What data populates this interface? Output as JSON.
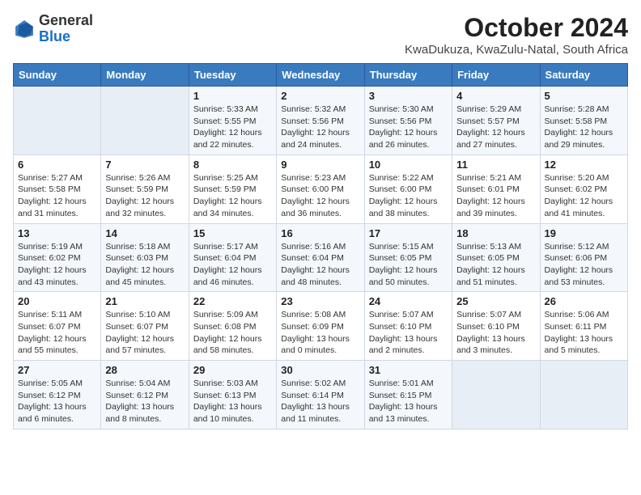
{
  "logo": {
    "text_general": "General",
    "text_blue": "Blue"
  },
  "header": {
    "month": "October 2024",
    "location": "KwaDukuza, KwaZulu-Natal, South Africa"
  },
  "weekdays": [
    "Sunday",
    "Monday",
    "Tuesday",
    "Wednesday",
    "Thursday",
    "Friday",
    "Saturday"
  ],
  "weeks": [
    [
      {
        "day": "",
        "info": ""
      },
      {
        "day": "",
        "info": ""
      },
      {
        "day": "1",
        "info": "Sunrise: 5:33 AM\nSunset: 5:55 PM\nDaylight: 12 hours\nand 22 minutes."
      },
      {
        "day": "2",
        "info": "Sunrise: 5:32 AM\nSunset: 5:56 PM\nDaylight: 12 hours\nand 24 minutes."
      },
      {
        "day": "3",
        "info": "Sunrise: 5:30 AM\nSunset: 5:56 PM\nDaylight: 12 hours\nand 26 minutes."
      },
      {
        "day": "4",
        "info": "Sunrise: 5:29 AM\nSunset: 5:57 PM\nDaylight: 12 hours\nand 27 minutes."
      },
      {
        "day": "5",
        "info": "Sunrise: 5:28 AM\nSunset: 5:58 PM\nDaylight: 12 hours\nand 29 minutes."
      }
    ],
    [
      {
        "day": "6",
        "info": "Sunrise: 5:27 AM\nSunset: 5:58 PM\nDaylight: 12 hours\nand 31 minutes."
      },
      {
        "day": "7",
        "info": "Sunrise: 5:26 AM\nSunset: 5:59 PM\nDaylight: 12 hours\nand 32 minutes."
      },
      {
        "day": "8",
        "info": "Sunrise: 5:25 AM\nSunset: 5:59 PM\nDaylight: 12 hours\nand 34 minutes."
      },
      {
        "day": "9",
        "info": "Sunrise: 5:23 AM\nSunset: 6:00 PM\nDaylight: 12 hours\nand 36 minutes."
      },
      {
        "day": "10",
        "info": "Sunrise: 5:22 AM\nSunset: 6:00 PM\nDaylight: 12 hours\nand 38 minutes."
      },
      {
        "day": "11",
        "info": "Sunrise: 5:21 AM\nSunset: 6:01 PM\nDaylight: 12 hours\nand 39 minutes."
      },
      {
        "day": "12",
        "info": "Sunrise: 5:20 AM\nSunset: 6:02 PM\nDaylight: 12 hours\nand 41 minutes."
      }
    ],
    [
      {
        "day": "13",
        "info": "Sunrise: 5:19 AM\nSunset: 6:02 PM\nDaylight: 12 hours\nand 43 minutes."
      },
      {
        "day": "14",
        "info": "Sunrise: 5:18 AM\nSunset: 6:03 PM\nDaylight: 12 hours\nand 45 minutes."
      },
      {
        "day": "15",
        "info": "Sunrise: 5:17 AM\nSunset: 6:04 PM\nDaylight: 12 hours\nand 46 minutes."
      },
      {
        "day": "16",
        "info": "Sunrise: 5:16 AM\nSunset: 6:04 PM\nDaylight: 12 hours\nand 48 minutes."
      },
      {
        "day": "17",
        "info": "Sunrise: 5:15 AM\nSunset: 6:05 PM\nDaylight: 12 hours\nand 50 minutes."
      },
      {
        "day": "18",
        "info": "Sunrise: 5:13 AM\nSunset: 6:05 PM\nDaylight: 12 hours\nand 51 minutes."
      },
      {
        "day": "19",
        "info": "Sunrise: 5:12 AM\nSunset: 6:06 PM\nDaylight: 12 hours\nand 53 minutes."
      }
    ],
    [
      {
        "day": "20",
        "info": "Sunrise: 5:11 AM\nSunset: 6:07 PM\nDaylight: 12 hours\nand 55 minutes."
      },
      {
        "day": "21",
        "info": "Sunrise: 5:10 AM\nSunset: 6:07 PM\nDaylight: 12 hours\nand 57 minutes."
      },
      {
        "day": "22",
        "info": "Sunrise: 5:09 AM\nSunset: 6:08 PM\nDaylight: 12 hours\nand 58 minutes."
      },
      {
        "day": "23",
        "info": "Sunrise: 5:08 AM\nSunset: 6:09 PM\nDaylight: 13 hours\nand 0 minutes."
      },
      {
        "day": "24",
        "info": "Sunrise: 5:07 AM\nSunset: 6:10 PM\nDaylight: 13 hours\nand 2 minutes."
      },
      {
        "day": "25",
        "info": "Sunrise: 5:07 AM\nSunset: 6:10 PM\nDaylight: 13 hours\nand 3 minutes."
      },
      {
        "day": "26",
        "info": "Sunrise: 5:06 AM\nSunset: 6:11 PM\nDaylight: 13 hours\nand 5 minutes."
      }
    ],
    [
      {
        "day": "27",
        "info": "Sunrise: 5:05 AM\nSunset: 6:12 PM\nDaylight: 13 hours\nand 6 minutes."
      },
      {
        "day": "28",
        "info": "Sunrise: 5:04 AM\nSunset: 6:12 PM\nDaylight: 13 hours\nand 8 minutes."
      },
      {
        "day": "29",
        "info": "Sunrise: 5:03 AM\nSunset: 6:13 PM\nDaylight: 13 hours\nand 10 minutes."
      },
      {
        "day": "30",
        "info": "Sunrise: 5:02 AM\nSunset: 6:14 PM\nDaylight: 13 hours\nand 11 minutes."
      },
      {
        "day": "31",
        "info": "Sunrise: 5:01 AM\nSunset: 6:15 PM\nDaylight: 13 hours\nand 13 minutes."
      },
      {
        "day": "",
        "info": ""
      },
      {
        "day": "",
        "info": ""
      }
    ]
  ]
}
